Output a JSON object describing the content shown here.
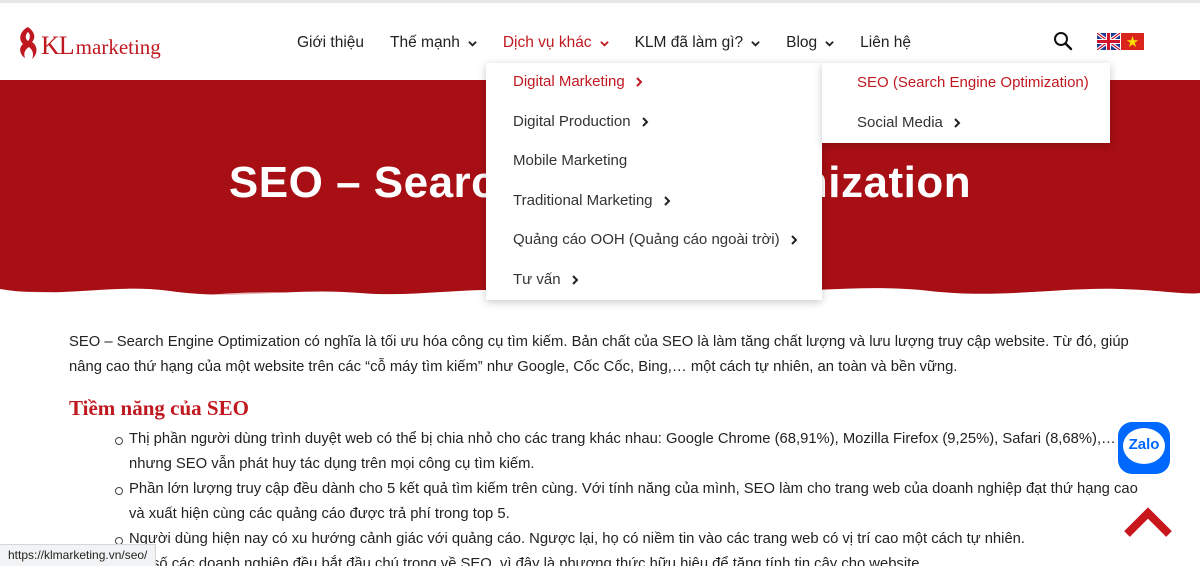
{
  "logo": {
    "mark": "KL",
    "word": "marketing"
  },
  "nav": {
    "items": [
      {
        "label": "Giới thiệu",
        "has_dropdown": false
      },
      {
        "label": "Thế mạnh",
        "has_dropdown": true
      },
      {
        "label": "Dịch vụ khác",
        "has_dropdown": true,
        "active": true
      },
      {
        "label": "KLM đã làm gì?",
        "has_dropdown": true
      },
      {
        "label": "Blog",
        "has_dropdown": true
      },
      {
        "label": "Liên hệ",
        "has_dropdown": false
      }
    ],
    "search_icon": "search-icon",
    "languages": [
      "english-flag-icon",
      "vietnam-flag-icon"
    ]
  },
  "dropdown": {
    "items": [
      {
        "label": "Digital Marketing",
        "submenu": true,
        "active": true
      },
      {
        "label": "Digital Production",
        "submenu": true
      },
      {
        "label": "Mobile Marketing",
        "submenu": false
      },
      {
        "label": "Traditional Marketing",
        "submenu": true
      },
      {
        "label": "Quảng cáo OOH (Quảng cáo ngoài trời)",
        "submenu": true
      },
      {
        "label": "Tư vấn",
        "submenu": true
      }
    ]
  },
  "submenu": {
    "items": [
      {
        "label": "SEO (Search Engine Optimization)",
        "active": true
      },
      {
        "label": "Social Media",
        "submenu": true
      }
    ]
  },
  "hero": {
    "title": "SEO – Search Engine Optimization"
  },
  "content": {
    "intro": "SEO – Search Engine Optimization có nghĩa là tối ưu hóa công cụ tìm kiếm. Bản chất của SEO là làm tăng chất lượng và lưu lượng truy cập website. Từ đó, giúp nâng cao thứ hạng của một website trên các “cỗ máy tìm kiếm” như Google, Cốc Cốc, Bing,… một cách tự nhiên, an toàn và bền vững.",
    "heading": "Tiềm năng của SEO",
    "bullets": [
      "Thị phần người dùng trình duyệt web có thể bị chia nhỏ cho các trang khác nhau: Google Chrome (68,91%), Mozilla Firefox (9,25%), Safari (8,68%),… nhưng SEO vẫn phát huy tác dụng trên mọi công cụ tìm kiếm.",
      "Phần lớn lượng truy cập đều dành cho 5 kết quả tìm kiếm trên cùng. Với tính năng của mình, SEO làm cho trang web của doanh nghiệp đạt thứ hạng cao và xuất hiện cùng các quảng cáo được trả phí trong top 5.",
      "Người dùng hiện nay có xu hướng cảnh giác với quảng cáo. Ngược lại, họ có niềm tin vào các trang web có vị trí cao một cách tự nhiên.",
      "Đa số các doanh nghiệp đều bắt đầu chú trọng về SEO, vì đây là phương thức hữu hiệu để tăng tính tin cậy cho website."
    ]
  },
  "widgets": {
    "zalo_label": "Zalo",
    "back_to_top": "chevron-up-icon"
  },
  "statusbar": {
    "url": "https://klmarketing.vn/seo/"
  },
  "colors": {
    "brand_red": "#c0181f",
    "hero_red": "#a70f14",
    "zalo_blue": "#0068ff"
  }
}
